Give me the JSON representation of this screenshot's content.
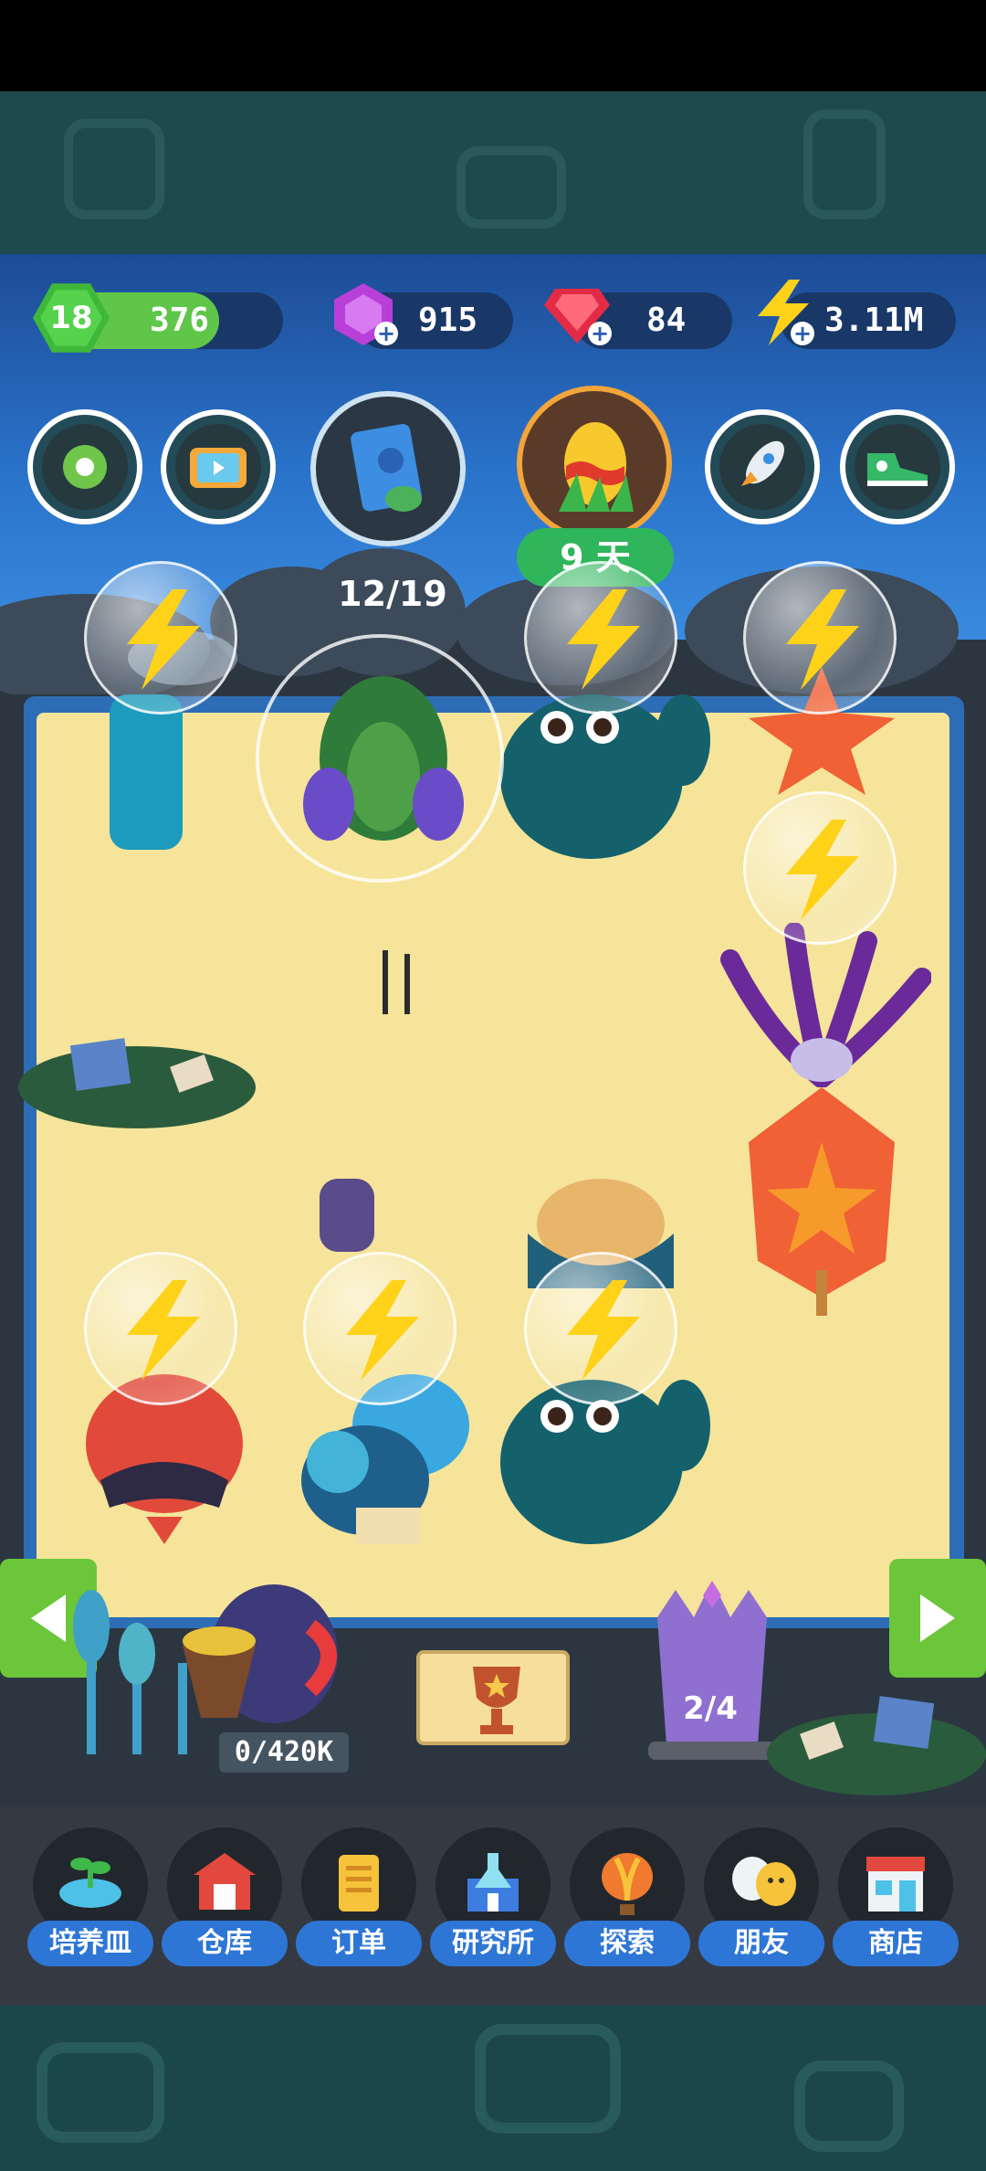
{
  "resources": {
    "level": "18",
    "xp": "376",
    "xp_progress": 0.72,
    "gems": "915",
    "rubies": "84",
    "energy": "3.11M"
  },
  "top_buttons": {
    "egg_timer": "9 天",
    "growth_counter": "12/19"
  },
  "garden": {
    "merchant_progress": "0/420K",
    "tower_count": "2/4"
  },
  "nav": [
    {
      "label": "培养皿",
      "icon": "petri-dish-icon"
    },
    {
      "label": "仓库",
      "icon": "warehouse-icon"
    },
    {
      "label": "订单",
      "icon": "orders-icon"
    },
    {
      "label": "研究所",
      "icon": "research-lab-icon"
    },
    {
      "label": "探索",
      "icon": "hot-air-balloon-icon"
    },
    {
      "label": "朋友",
      "icon": "friends-icon"
    },
    {
      "label": "商店",
      "icon": "shop-icon"
    }
  ],
  "colors": {
    "xp_bar": "#5fc64a",
    "nav_label": "#2d76d5",
    "days_badge": "#2fb55b",
    "sand": "#f5e49a",
    "arrow": "#6cc63a"
  }
}
